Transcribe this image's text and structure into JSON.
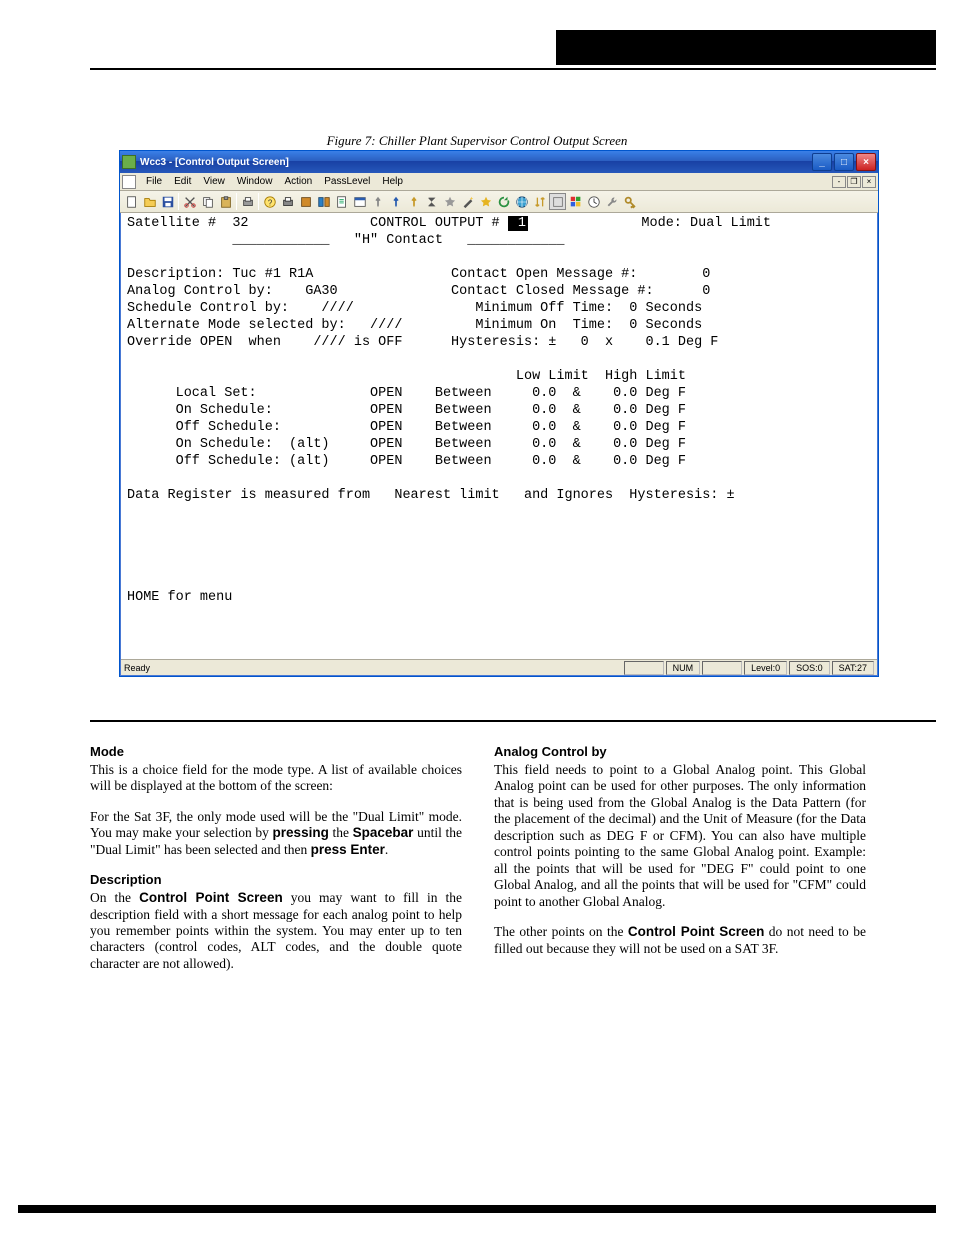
{
  "screenshot": {
    "window": {
      "title": "Wcc3 - [Control Output Screen]",
      "menu": [
        "File",
        "Edit",
        "View",
        "Window",
        "Action",
        "PassLevel",
        "Help"
      ]
    },
    "header": {
      "satellite_lbl": "Satellite #",
      "satellite_val": "32",
      "title": "CONTROL OUTPUT #",
      "output_num": "1",
      "mode_lbl": "Mode:",
      "mode_val": "Dual Limit",
      "contact": "\"H\" Contact"
    },
    "left": {
      "l1a": "Description:",
      "l1b": "Tuc #1 R1A",
      "l2a": "Analog Control by:",
      "l2b": "GA30",
      "l3a": "Schedule Control by:",
      "l3b": "////",
      "l4a": "Alternate Mode selected by:",
      "l4b": "////",
      "l5a": "Override OPEN  when",
      "l5b": "//// is OFF"
    },
    "right": {
      "r1a": "Contact Open Message #:",
      "r1b": "0",
      "r2a": "Contact Closed Message #:",
      "r2b": "0",
      "r3a": "Minimum Off Time:",
      "r3b": "0 Seconds",
      "r4a": "Minimum On  Time:",
      "r4b": "0 Seconds",
      "r5a": "Hysteresis: ±",
      "r5b": "0",
      "r5c": "x",
      "r5d": "0.1 Deg F"
    },
    "limits": {
      "hdr_lo": "Low Limit",
      "hdr_hi": "High Limit",
      "rows": [
        {
          "name": "Local Set:",
          "state": "OPEN",
          "word": "Between",
          "lo": "0.0",
          "amp": "&",
          "hi": "0.0",
          "unit": "Deg F"
        },
        {
          "name": "On Schedule:",
          "state": "OPEN",
          "word": "Between",
          "lo": "0.0",
          "amp": "&",
          "hi": "0.0",
          "unit": "Deg F"
        },
        {
          "name": "Off Schedule:",
          "state": "OPEN",
          "word": "Between",
          "lo": "0.0",
          "amp": "&",
          "hi": "0.0",
          "unit": "Deg F"
        },
        {
          "name": "On Schedule:  (alt)",
          "state": "OPEN",
          "word": "Between",
          "lo": "0.0",
          "amp": "&",
          "hi": "0.0",
          "unit": "Deg F"
        },
        {
          "name": "Off Schedule: (alt)",
          "state": "OPEN",
          "word": "Between",
          "lo": "0.0",
          "amp": "&",
          "hi": "0.0",
          "unit": "Deg F"
        }
      ]
    },
    "datareg": "Data Register is measured from   Nearest limit   and Ignores  Hysteresis: ±",
    "footer": "HOME for menu",
    "status": {
      "ready": "Ready",
      "num": "NUM",
      "level": "Level:0",
      "sos": "SOS:0",
      "sat": "SAT:27"
    }
  },
  "figcap": "Figure 7: Chiller Plant Supervisor Control Output Screen",
  "body": {
    "mode": {
      "h": "Mode",
      "p1": "This is a choice field for the mode type. A list of available choices will be displayed at the bottom of the screen:",
      "p2a": "For the Sat 3F, the only mode used will be the \"Dual Limit\" mode. You may make your selection by ",
      "p2k1": "pressing",
      "p2b": " the ",
      "p2k2": "Spacebar",
      "p2c": " until the \"Dual Limit\" has been selected and then ",
      "p2k3": "press Enter",
      "p2d": "."
    },
    "desc": {
      "h": "Description",
      "p1a": "On the ",
      "p1k1": "Control Point Screen",
      "p1b": " you may want to fill in the description field with a short message for each analog point to help you remember points within the system. You may enter up to ten characters (control codes, ALT codes, and the double quote character are not allowed)."
    },
    "analog": {
      "h": "Analog Control by",
      "p1": "This field needs to point to a Global Analog point. This Global Analog point can be used for other purposes. The only information that is being used from the Global Analog is the Data Pattern (for the placement of the decimal) and the Unit of Measure (for the Data description such as DEG F or CFM). You can also have multiple control points pointing to the same Global Analog point. Example: all the points that will be used for \"DEG F\" could point to one Global Analog, and all the points that will be used for \"CFM\" could point to another Global Analog.",
      "p2a": "The other points on the ",
      "p2k1": "Control Point Screen",
      "p2b": " do not need to be filled out because they will not be used on a SAT 3F."
    }
  }
}
